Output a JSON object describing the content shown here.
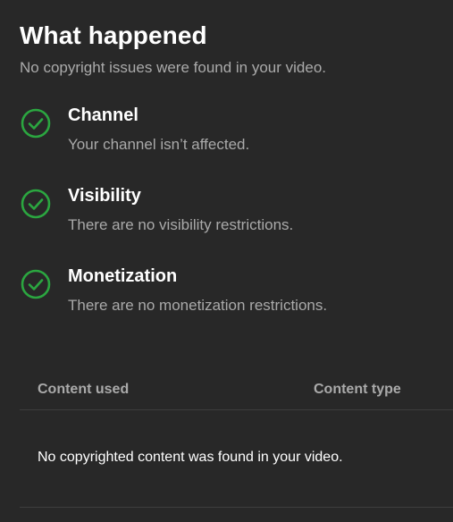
{
  "header": {
    "title": "What happened",
    "subtitle": "No copyright issues were found in your video."
  },
  "statuses": [
    {
      "icon": "check-circle-icon",
      "title": "Channel",
      "description": "Your channel isn’t affected."
    },
    {
      "icon": "check-circle-icon",
      "title": "Visibility",
      "description": "There are no visibility restrictions."
    },
    {
      "icon": "check-circle-icon",
      "title": "Monetization",
      "description": "There are no monetization restrictions."
    }
  ],
  "table": {
    "columns": [
      "Content used",
      "Content type"
    ],
    "empty_message": "No copyrighted content was found in your video."
  },
  "colors": {
    "background": "#282828",
    "success": "#2ba640",
    "text_primary": "#ffffff",
    "text_secondary": "#aaaaaa",
    "divider": "#3e3e3e"
  }
}
